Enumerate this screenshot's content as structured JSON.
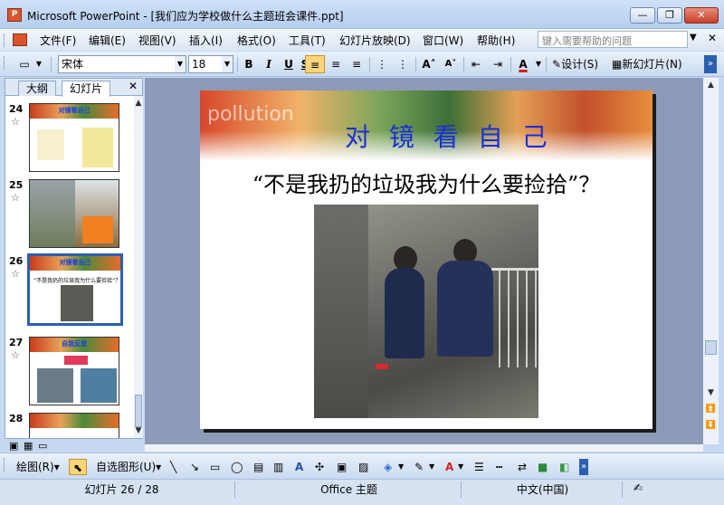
{
  "window": {
    "title": "Microsoft PowerPoint - [我们应为学校做什么主题班会课件.ppt]",
    "app_icon": "P",
    "minimize": "—",
    "restore": "❐",
    "close": "✕"
  },
  "menu": {
    "items": [
      "文件(F)",
      "编辑(E)",
      "视图(V)",
      "插入(I)",
      "格式(O)",
      "工具(T)",
      "幻灯片放映(D)",
      "窗口(W)",
      "帮助(H)"
    ],
    "help_placeholder": "键入需要帮助的问题",
    "close": "✕"
  },
  "toolbar": {
    "font": "宋体",
    "size": "18",
    "bold": "B",
    "italic": "I",
    "underline": "U",
    "design": "设计(S)",
    "new_slide": "新幻灯片(N)"
  },
  "left_panel": {
    "tabs": [
      "大纲",
      "幻灯片"
    ],
    "close": "✕",
    "slides": [
      {
        "num": "24",
        "title": "对镜看自己"
      },
      {
        "num": "25",
        "title": ""
      },
      {
        "num": "26",
        "title": "对镜看自己",
        "sub": "“不是我扔的垃圾我为什么要捡拾”？"
      },
      {
        "num": "27",
        "title": "自我反思"
      },
      {
        "num": "28",
        "title": ""
      }
    ]
  },
  "slide": {
    "banner_word": "pollution",
    "title": "对 镜 看 自 己",
    "text": "“不是我扔的垃圾我为什么要捡拾”？"
  },
  "draw": {
    "draw_label": "绘图(R)",
    "autoshapes": "自选图形(U)"
  },
  "status": {
    "slide": "幻灯片 26 / 28",
    "theme": "Office 主题",
    "lang": "中文(中国)"
  }
}
